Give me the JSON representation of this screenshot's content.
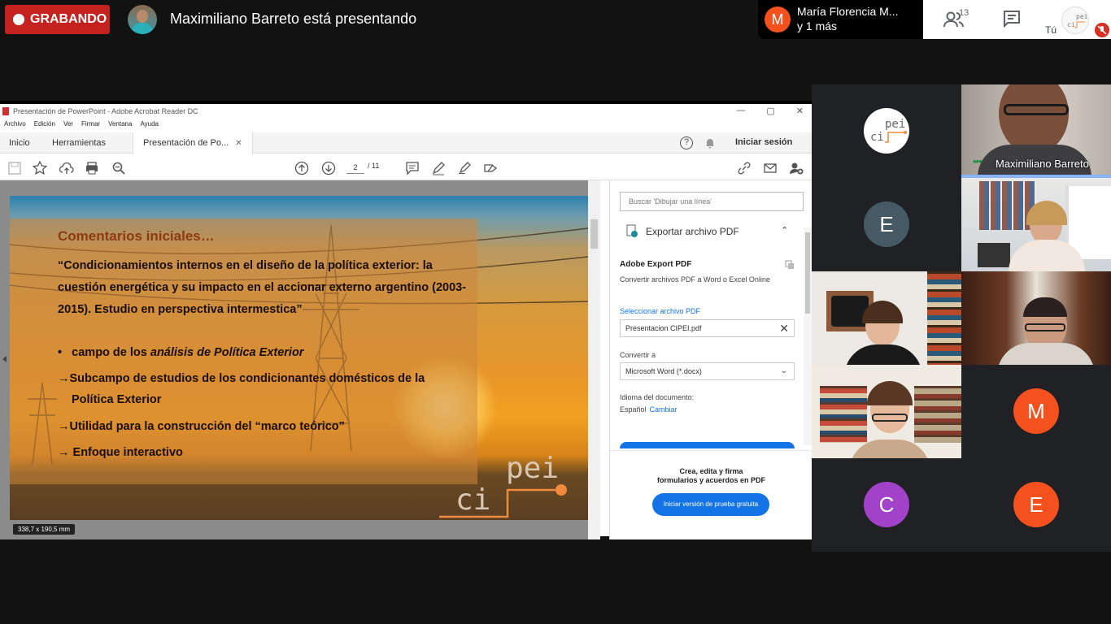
{
  "meet": {
    "recording_label": "GRABANDO",
    "presenting_text": "Maximiliano Barreto está presentando",
    "other_users_line1": "María Florencia M...",
    "other_users_line2": "y 1 más",
    "other_users_initial": "M",
    "participants_count": "13",
    "self_label": "Tú",
    "icons": [
      "people-icon",
      "chat-icon",
      "mic-off-icon"
    ]
  },
  "acrobat": {
    "window_title": "Presentación de PowerPoint - Adobe Acrobat Reader DC",
    "menu": [
      "Archivo",
      "Edición",
      "Ver",
      "Firmar",
      "Ventana",
      "Ayuda"
    ],
    "tabs": [
      "Inicio",
      "Herramientas"
    ],
    "active_tab": "Presentación de Po...",
    "sign_in": "Iniciar sesión",
    "page_current": "2",
    "page_total": "/ 11",
    "page_size": "338,7 x 190,5 mm",
    "slide": {
      "title": "Comentarios iniciales…",
      "quote": "“Condicionamientos internos en el diseño de la política exterior: la cuestión energética y su impacto en el accionar externo argentino (2003-2015). Estudio en perspectiva intermestica”",
      "bullet1_prefix": "•",
      "bullet1_text": "campo de los ",
      "bullet1_em": "análisis de Política Exterior",
      "bullet2_l1": "→Subcampo de estudios de los condicionantes domésticos de la",
      "bullet2_l2": "Política Exterior",
      "bullet3": "→Utilidad para la construcción del “marco teórico”",
      "bullet4": "→ Enfoque interactivo",
      "logo_top": "pei",
      "logo_bottom": "ci"
    },
    "side": {
      "search_placeholder": "Buscar 'Dibujar una línea'",
      "export_title": "Exportar archivo PDF",
      "export_heading": "Adobe Export PDF",
      "export_sub": "Convertir archivos PDF a Word o Excel Online",
      "select_label": "Seleccionar archivo PDF",
      "file_name": "Presentacion CIPEI.pdf",
      "convert_label": "Convertir a",
      "format": "Microsoft Word (*.docx)",
      "lang_label": "Idioma del documento:",
      "lang_value": "Español",
      "lang_change": "Cambiar",
      "promo_line1": "Crea, edita y firma",
      "promo_line2": "formularios y acuerdos en PDF",
      "trial_button": "Iniciar versión de prueba gratuita"
    }
  },
  "participants": {
    "logo_text_top": "pei",
    "logo_text_bottom": "ci",
    "tile_e1": "E",
    "presenter_name": "Maximiliano Barreto",
    "tile_m": "M",
    "tile_c": "C",
    "tile_e2": "E"
  },
  "colors": {
    "recording_red": "#c5221f",
    "avatar_orange": "#f4511e",
    "avatar_purple": "#a142c9",
    "avatar_slate": "#455a64",
    "acrobat_blue": "#1473e6"
  }
}
